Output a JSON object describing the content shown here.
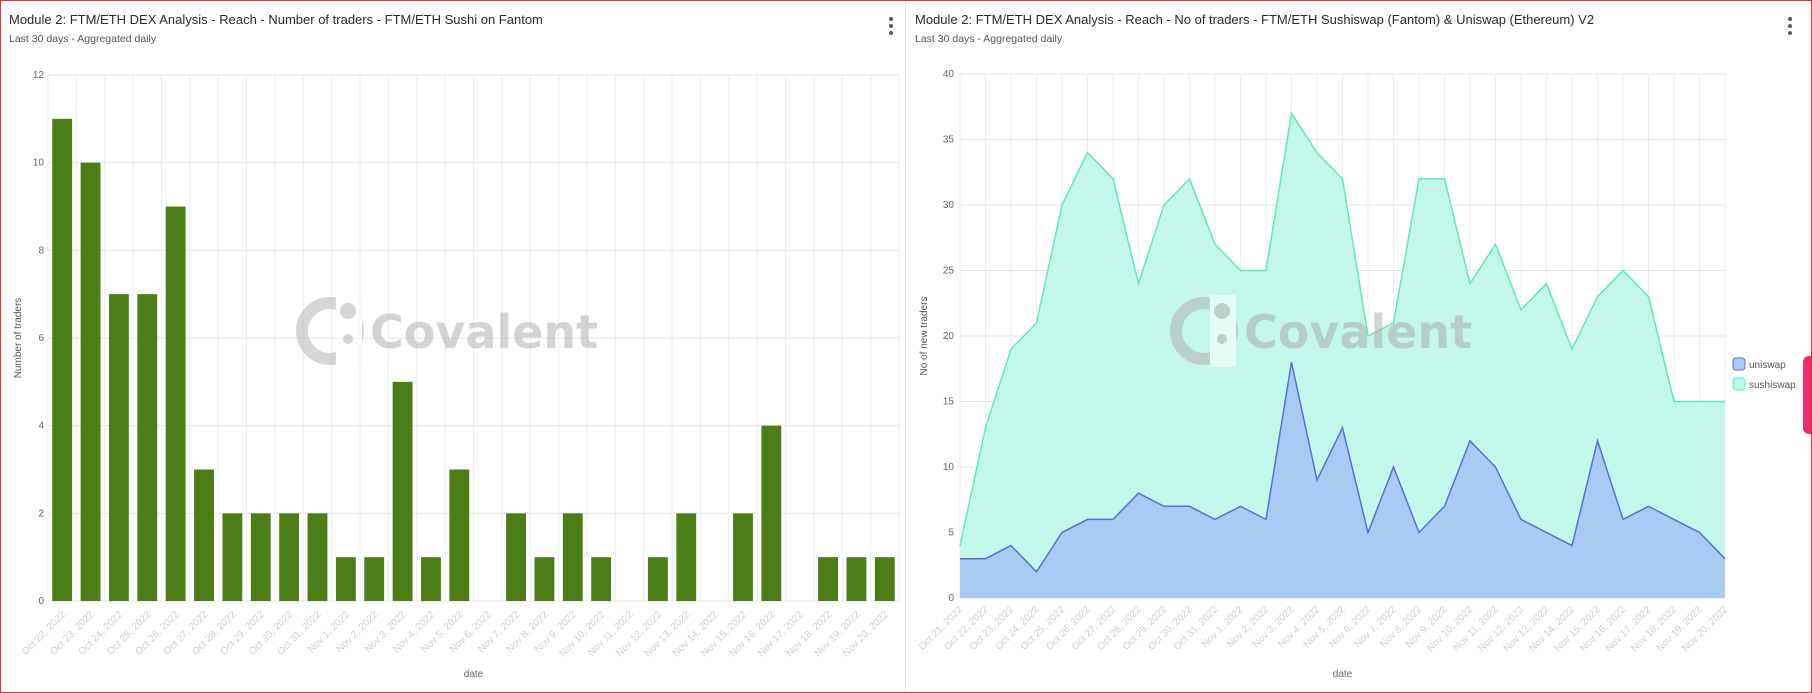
{
  "left_panel": {
    "title": "Module 2: FTM/ETH DEX Analysis - Reach - Number of traders - FTM/ETH Sushi on Fantom",
    "subtitle": "Last 30 days - Aggregated daily",
    "menu_icon": "kebab-menu-icon"
  },
  "right_panel": {
    "title": "Module 2: FTM/ETH DEX Analysis - Reach - No of traders - FTM/ETH Sushiswap (Fantom) & Uniswap (Ethereum) V2",
    "subtitle": "Last 30 days - Aggregated daily",
    "menu_icon": "kebab-menu-icon"
  },
  "watermark": {
    "text": "Covalent"
  },
  "chart_data": [
    {
      "type": "bar",
      "title": "Module 2: FTM/ETH DEX Analysis - Reach - Number of traders - FTM/ETH Sushi on Fantom",
      "xlabel": "date",
      "ylabel": "Number of traders",
      "ylim": [
        0,
        12
      ],
      "yticks": [
        0,
        2,
        4,
        6,
        8,
        10,
        12
      ],
      "grid": true,
      "color": "#4d7d17",
      "categories": [
        "Oct 22, 2022",
        "Oct 23, 2022",
        "Oct 24, 2022",
        "Oct 25, 2022",
        "Oct 26, 2022",
        "Oct 27, 2022",
        "Oct 28, 2022",
        "Oct 29, 2022",
        "Oct 30, 2022",
        "Oct 31, 2022",
        "Nov 1, 2022",
        "Nov 2, 2022",
        "Nov 3, 2022",
        "Nov 4, 2022",
        "Nov 5, 2022",
        "Nov 6, 2022",
        "Nov 7, 2022",
        "Nov 8, 2022",
        "Nov 9, 2022",
        "Nov 10, 2022",
        "Nov 11, 2022",
        "Nov 12, 2022",
        "Nov 13, 2022",
        "Nov 14, 2022",
        "Nov 15, 2022",
        "Nov 16, 2022",
        "Nov 17, 2022",
        "Nov 18, 2022",
        "Nov 19, 2022",
        "Nov 20, 2022"
      ],
      "values": [
        11,
        10,
        7,
        7,
        9,
        3,
        2,
        2,
        2,
        2,
        1,
        1,
        5,
        1,
        3,
        0,
        2,
        1,
        2,
        1,
        0,
        1,
        2,
        0,
        2,
        4,
        0,
        1,
        1,
        1
      ]
    },
    {
      "type": "area",
      "title": "Module 2: FTM/ETH DEX Analysis - Reach - No of traders - FTM/ETH Sushiswap (Fantom) & Uniswap (Ethereum) V2",
      "xlabel": "date",
      "ylabel": "No of new traders",
      "ylim": [
        0,
        40
      ],
      "yticks": [
        0,
        5,
        10,
        15,
        20,
        25,
        30,
        35,
        40
      ],
      "grid": true,
      "stacked": true,
      "legend_position": "right",
      "x": [
        "Oct 21, 2022",
        "Oct 22, 2022",
        "Oct 23, 2022",
        "Oct 24, 2022",
        "Oct 25, 2022",
        "Oct 26, 2022",
        "Oct 27, 2022",
        "Oct 28, 2022",
        "Oct 29, 2022",
        "Oct 30, 2022",
        "Oct 31, 2022",
        "Nov 1, 2022",
        "Nov 2, 2022",
        "Nov 3, 2022",
        "Nov 4, 2022",
        "Nov 5, 2022",
        "Nov 6, 2022",
        "Nov 7, 2022",
        "Nov 8, 2022",
        "Nov 9, 2022",
        "Nov 10, 2022",
        "Nov 11, 2022",
        "Nov 12, 2022",
        "Nov 13, 2022",
        "Nov 14, 2022",
        "Nov 15, 2022",
        "Nov 16, 2022",
        "Nov 17, 2022",
        "Nov 18, 2022",
        "Nov 19, 2022",
        "Nov 20, 2022"
      ],
      "series": [
        {
          "name": "uniswap",
          "color": "#5b6fd8",
          "fill": "#a8c9f2",
          "values": [
            3,
            3,
            4,
            2,
            5,
            6,
            6,
            8,
            7,
            7,
            6,
            7,
            6,
            18,
            9,
            13,
            5,
            10,
            5,
            7,
            12,
            10,
            6,
            5,
            4,
            12,
            6,
            7,
            6,
            5,
            3
          ]
        },
        {
          "name": "sushiswap",
          "color": "#5ee8c4",
          "fill": "#c3f7e9",
          "values": [
            1,
            10,
            15,
            19,
            25,
            28,
            26,
            16,
            23,
            25,
            21,
            18,
            19,
            19,
            25,
            19,
            15,
            11,
            27,
            25,
            12,
            17,
            16,
            19,
            15,
            11,
            19,
            16,
            9,
            10,
            12
          ]
        }
      ]
    }
  ]
}
